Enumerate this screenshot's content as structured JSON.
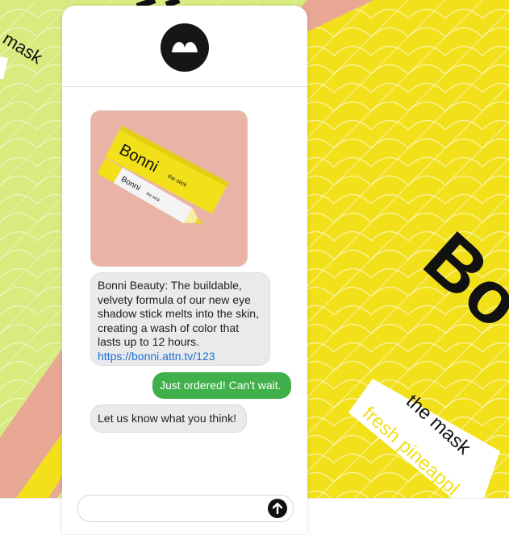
{
  "background": {
    "colors": {
      "lime": "#d7eb7e",
      "yellow": "#f2e01b",
      "pink": "#e8a893",
      "black": "#111111"
    },
    "brand_text": "Bo",
    "tagline": "the mask",
    "flavor": "fresh pineappl",
    "corner_text": "mask"
  },
  "chat": {
    "header": {
      "avatar_icon": "bonni-logo-icon"
    },
    "product_image": {
      "box_brand": "Bonni",
      "box_subtitle": "the stick",
      "pencil_brand": "Bonni",
      "pencil_subtitle": "the stick"
    },
    "messages": {
      "incoming_1_line_1": "Bonni Beauty: The buildable,",
      "incoming_1_line_2": "velvety formula of our new eye",
      "incoming_1_line_3": "shadow stick melts into the skin,",
      "incoming_1_line_4": "creating a wash of color that",
      "incoming_1_line_5": "lasts up to 12 hours.",
      "incoming_1_link": "https://bonni.attn.tv/123",
      "outgoing_1": "Just ordered! Can't wait.",
      "incoming_2": "Let us know what you think!"
    },
    "colors": {
      "outgoing_bubble": "#3fb04a",
      "incoming_bubble": "#e9eaec",
      "link": "#1f6fd6"
    },
    "input": {
      "placeholder": "",
      "send_icon": "arrow-up-icon"
    }
  }
}
